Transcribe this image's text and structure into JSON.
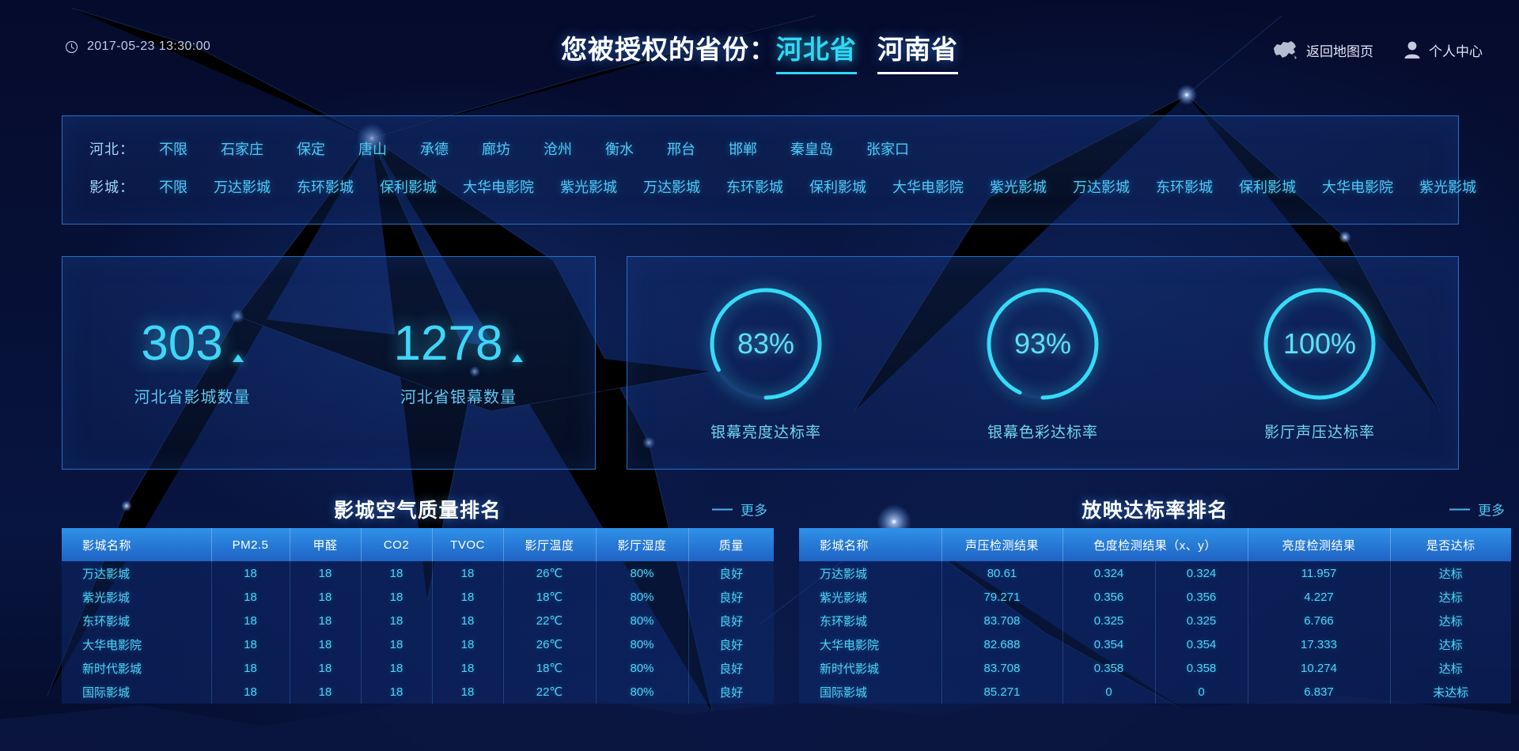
{
  "header": {
    "clock_icon": "clock-icon",
    "datetime": "2017-05-23  13:30:00",
    "title_prefix": "您被授权的省份：",
    "provinces": [
      {
        "label": "河北省",
        "active": true
      },
      {
        "label": "河南省",
        "active": false
      }
    ],
    "map_icon": "china-map-icon",
    "map_link": "返回地图页",
    "user_icon": "user-avatar-icon",
    "user_link": "个人中心"
  },
  "filters": {
    "city": {
      "label": "河北：",
      "items": [
        "不限",
        "石家庄",
        "保定",
        "唐山",
        "承德",
        "廊坊",
        "沧州",
        "衡水",
        "邢台",
        "邯郸",
        "秦皇岛",
        "张家口"
      ]
    },
    "cinema": {
      "label": "影城：",
      "items": [
        "不限",
        "万达影城",
        "东环影城",
        "保利影城",
        "大华电影院",
        "紫光影城",
        "万达影城",
        "东环影城",
        "保利影城",
        "大华电影院",
        "紫光影城",
        "万达影城",
        "东环影城",
        "保利影城",
        "大华电影院",
        "紫光影城"
      ]
    }
  },
  "stats": [
    {
      "value": "303",
      "label": "河北省影城数量",
      "trend": "up"
    },
    {
      "value": "1278",
      "label": "河北省银幕数量",
      "trend": "up"
    }
  ],
  "gauges": [
    {
      "value": "83%",
      "percent": 83,
      "label": "银幕亮度达标率"
    },
    {
      "value": "93%",
      "percent": 93,
      "label": "银幕色彩达标率"
    },
    {
      "value": "100%",
      "percent": 100,
      "label": "影厅声压达标率"
    }
  ],
  "colors": {
    "accent_cyan": "#2fd8f5",
    "text_cyan": "#4fd3f5",
    "panel_border": "#2a6fbe",
    "table_header_top": "#2f91e8",
    "table_header_bottom": "#1f63c4",
    "background": "#050b2e"
  },
  "air_table": {
    "title": "影城空气质量排名",
    "more_label": "更多",
    "columns": [
      "影城名称",
      "PM2.5",
      "甲醛",
      "CO2",
      "TVOC",
      "影厅温度",
      "影厅湿度",
      "质量"
    ],
    "rows": [
      [
        "万达影城",
        "18",
        "18",
        "18",
        "18",
        "26℃",
        "80%",
        "良好"
      ],
      [
        "紫光影城",
        "18",
        "18",
        "18",
        "18",
        "18℃",
        "80%",
        "良好"
      ],
      [
        "东环影城",
        "18",
        "18",
        "18",
        "18",
        "22℃",
        "80%",
        "良好"
      ],
      [
        "大华电影院",
        "18",
        "18",
        "18",
        "18",
        "26℃",
        "80%",
        "良好"
      ],
      [
        "新时代影城",
        "18",
        "18",
        "18",
        "18",
        "18℃",
        "80%",
        "良好"
      ],
      [
        "国际影城",
        "18",
        "18",
        "18",
        "18",
        "22℃",
        "80%",
        "良好"
      ]
    ]
  },
  "screen_table": {
    "title": "放映达标率排名",
    "more_label": "更多",
    "columns": [
      "影城名称",
      "声压检测结果",
      "色度检测结果（x、y）",
      "亮度检测结果",
      "是否达标"
    ],
    "rows": [
      [
        "万达影城",
        "80.61",
        "0.324",
        "0.324",
        "11.957",
        "达标"
      ],
      [
        "紫光影城",
        "79.271",
        "0.356",
        "0.356",
        "4.227",
        "达标"
      ],
      [
        "东环影城",
        "83.708",
        "0.325",
        "0.325",
        "6.766",
        "达标"
      ],
      [
        "大华电影院",
        "82.688",
        "0.354",
        "0.354",
        "17.333",
        "达标"
      ],
      [
        "新时代影城",
        "83.708",
        "0.358",
        "0.358",
        "10.274",
        "达标"
      ],
      [
        "国际影城",
        "85.271",
        "0",
        "0",
        "6.837",
        "未达标"
      ]
    ]
  }
}
